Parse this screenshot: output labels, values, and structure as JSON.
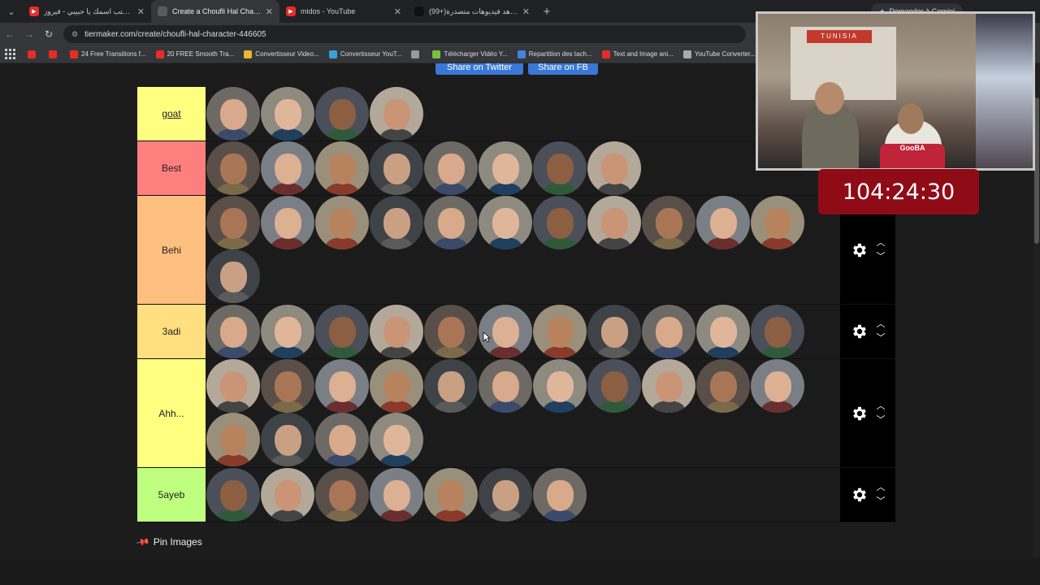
{
  "browser": {
    "tabs": [
      {
        "title": "ﺑﻜﺘﺐ اﺳﻤﻚ ﻳﺎ ﺣﺒﻴﺒﻲ - ﻓﻴﺮوز | be",
        "favicon": "youtube-icon",
        "active": false
      },
      {
        "title": "Create a Choufli Hal Character",
        "favicon": "tiermaker-icon",
        "active": true
      },
      {
        "title": "midos - YouTube",
        "favicon": "youtube-icon",
        "active": false
      },
      {
        "title": "(99+)ﺷﺎﻫﺪ ﻓﻴﺪﻳﻮﻫﺎت ﻣﺘﺼﺪرة |",
        "favicon": "tiktok-icon",
        "active": false
      }
    ],
    "gemini_label": "Demander à Gemini",
    "url": "tiermaker.com/create/choufli-hal-character-446605",
    "bookmarks": [
      {
        "label": "",
        "color": "#e52d27"
      },
      {
        "label": "",
        "color": "#e52d27"
      },
      {
        "label": "24 Free Transitions f...",
        "color": "#e52d27"
      },
      {
        "label": "20 FREE Smooth Tra...",
        "color": "#e52d27"
      },
      {
        "label": "Convertisseur Video...",
        "color": "#e8b72a"
      },
      {
        "label": "Convertisseur YouT...",
        "color": "#3aa0d8"
      },
      {
        "label": "",
        "color": "#999999"
      },
      {
        "label": "Télécharger Vidéo Y...",
        "color": "#7bc043"
      },
      {
        "label": "Repartition des tach...",
        "color": "#4a7fe0"
      },
      {
        "label": "Text and Image ani...",
        "color": "#e52d27"
      },
      {
        "label": "YouTube Converter...",
        "color": "#aaaaaa"
      }
    ]
  },
  "share": {
    "twitter": "Share on Twitter",
    "facebook": "Share on FB"
  },
  "tiers": [
    {
      "label": "goat",
      "color": "#ffff7f",
      "count": 4,
      "ctrl": false
    },
    {
      "label": "Best",
      "color": "#ff7f7f",
      "count": 8,
      "ctrl": false
    },
    {
      "label": "Behi",
      "color": "#ffbf7f",
      "count": 12,
      "ctrl": true
    },
    {
      "label": "3adi",
      "color": "#ffdf7f",
      "count": 11,
      "ctrl": true
    },
    {
      "label": "Ahh...",
      "color": "#ffff7f",
      "count": 15,
      "ctrl": true
    },
    {
      "label": "5ayeb",
      "color": "#bfff7f",
      "count": 7,
      "ctrl": true
    }
  ],
  "pin_images_label": "Pin Images",
  "stream": {
    "timer": "104:24:30",
    "banner": "TUNISIA",
    "chair_text": "GooBA"
  }
}
